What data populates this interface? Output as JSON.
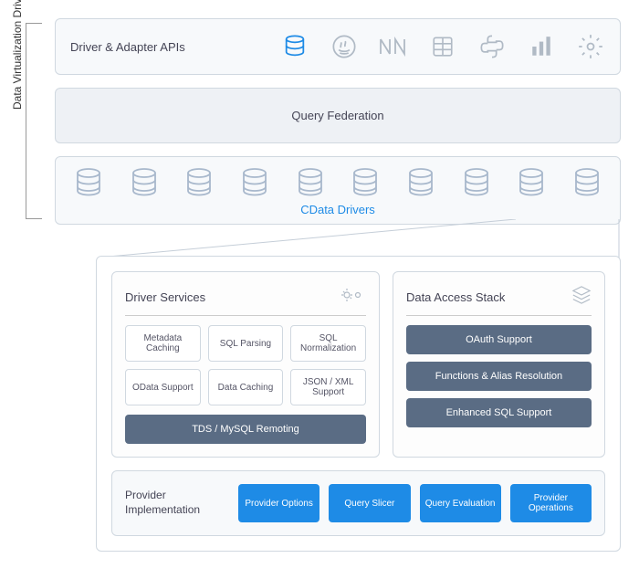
{
  "vertical_label": "Data Virtualization Driver",
  "apis": {
    "label": "Driver & Adapter APIs",
    "icons": [
      "database-icon",
      "java-icon",
      "dotnet-icon",
      "table-icon",
      "python-icon",
      "powerbi-icon",
      "gear-icon"
    ]
  },
  "federation": {
    "label": "Query Federation"
  },
  "drivers": {
    "label": "CData Drivers"
  },
  "driver_services": {
    "title": "Driver Services",
    "items": [
      "Metadata Caching",
      "SQL Parsing",
      "SQL Normalization",
      "OData Support",
      "Data Caching",
      "JSON / XML Support"
    ],
    "bar": "TDS / MySQL Remoting"
  },
  "data_access": {
    "title": "Data Access Stack",
    "bars": [
      "OAuth Support",
      "Functions & Alias Resolution",
      "Enhanced SQL Support"
    ]
  },
  "provider": {
    "label": "Provider Implementation",
    "chips": [
      "Provider Options",
      "Query Slicer",
      "Query Evaluation",
      "Provider Operations"
    ]
  }
}
